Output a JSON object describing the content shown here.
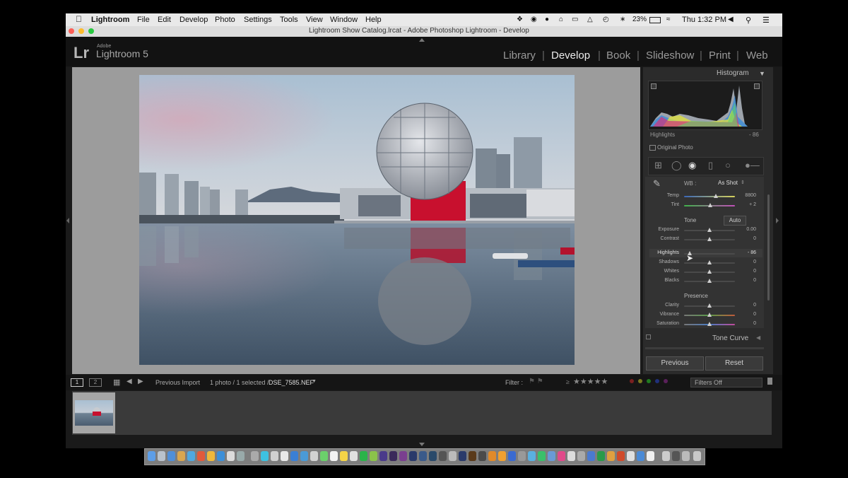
{
  "menubar": {
    "apple": "",
    "items": [
      "Lightroom",
      "File",
      "Edit",
      "Develop",
      "Photo",
      "Settings",
      "Tools",
      "View",
      "Window",
      "Help"
    ],
    "battery": "23%",
    "clock": "Thu 1:32 PM"
  },
  "window": {
    "title": "Lightroom Show Catalog.lrcat - Adobe Photoshop Lightroom - Develop"
  },
  "identity": {
    "brand_small": "Adobe",
    "brand": "Lightroom 5",
    "logo": "Lr"
  },
  "modules": [
    "Library",
    "Develop",
    "Book",
    "Slideshow",
    "Print",
    "Web"
  ],
  "active_module": "Develop",
  "histogram": {
    "title": "Histogram",
    "readout_label": "Highlights",
    "readout_value": "- 86",
    "original_photo": "Original Photo"
  },
  "basic": {
    "wb_label": "WB :",
    "wb_value": "As Shot",
    "tone_label": "Tone",
    "auto": "Auto",
    "presence_label": "Presence",
    "sliders": [
      {
        "label": "Temp",
        "value": "8800"
      },
      {
        "label": "Tint",
        "value": "+ 2"
      },
      {
        "label": "Exposure",
        "value": "0.00"
      },
      {
        "label": "Contrast",
        "value": "0"
      },
      {
        "label": "Highlights",
        "value": "- 86"
      },
      {
        "label": "Shadows",
        "value": "0"
      },
      {
        "label": "Whites",
        "value": "0"
      },
      {
        "label": "Blacks",
        "value": "0"
      },
      {
        "label": "Clarity",
        "value": "0"
      },
      {
        "label": "Vibrance",
        "value": "0"
      },
      {
        "label": "Saturation",
        "value": "0"
      }
    ]
  },
  "tone_curve": {
    "title": "Tone Curve"
  },
  "buttons": {
    "previous": "Previous",
    "reset": "Reset"
  },
  "toolbar": {
    "page1": "1",
    "page2": "2",
    "source": "Previous Import",
    "count": "1 photo / 1 selected /",
    "filename": "DSE_7585.NEF",
    "filter_label": "Filter :",
    "rating_op": "≥",
    "filters_off": "Filters Off"
  },
  "colors": {
    "accent_red": "#c8102e",
    "panel": "#2b2b2b",
    "canvas": "#9c9c9c"
  }
}
